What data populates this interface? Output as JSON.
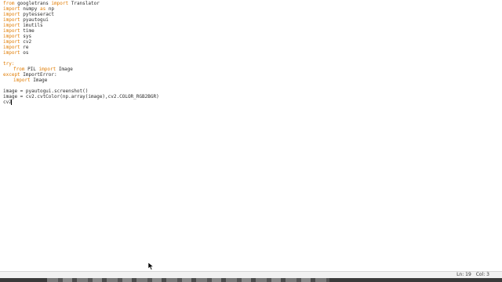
{
  "editor": {
    "lines": [
      {
        "kw1": "from",
        "mid": " googletrans ",
        "kw2": "import",
        "rest": " Translator"
      },
      {
        "kw1": "import",
        "mid": " numpy ",
        "kw2": "as",
        "rest": " np"
      },
      {
        "kw1": "import",
        "mid": " pytesseract",
        "kw2": "",
        "rest": ""
      },
      {
        "kw1": "import",
        "mid": " pyautogui",
        "kw2": "",
        "rest": ""
      },
      {
        "kw1": "import",
        "mid": " imutils",
        "kw2": "",
        "rest": ""
      },
      {
        "kw1": "import",
        "mid": " time",
        "kw2": "",
        "rest": ""
      },
      {
        "kw1": "import",
        "mid": " sys",
        "kw2": "",
        "rest": ""
      },
      {
        "kw1": "import",
        "mid": " cv2",
        "kw2": "",
        "rest": ""
      },
      {
        "kw1": "import",
        "mid": " re",
        "kw2": "",
        "rest": ""
      },
      {
        "kw1": "import",
        "mid": " os",
        "kw2": "",
        "rest": ""
      },
      {
        "kw1": "try:",
        "mid": "",
        "kw2": "",
        "rest": ""
      },
      {
        "kw1": "from",
        "mid": " PIL ",
        "kw2": "import",
        "rest": " Image"
      },
      {
        "kw1": "except",
        "mid": " ImportError:",
        "kw2": "",
        "rest": ""
      },
      {
        "kw1": "import",
        "mid": " Image",
        "kw2": "",
        "rest": ""
      },
      {
        "kw1": "",
        "mid": "image = pyautogui.screenshot()",
        "kw2": "",
        "rest": ""
      },
      {
        "kw1": "",
        "mid": "image = cv2.cvtColor(np.array(image),cv2.COLOR_RGB2BGR)",
        "kw2": "",
        "rest": ""
      },
      {
        "kw1": "",
        "mid": "cv2",
        "kw2": "",
        "rest": ""
      }
    ]
  },
  "status": {
    "ln": "Ln: 19",
    "col": "Col: 3"
  },
  "colors": {
    "keyword": "#e07b00",
    "text": "#2b2b2b",
    "background": "#ffffff"
  }
}
